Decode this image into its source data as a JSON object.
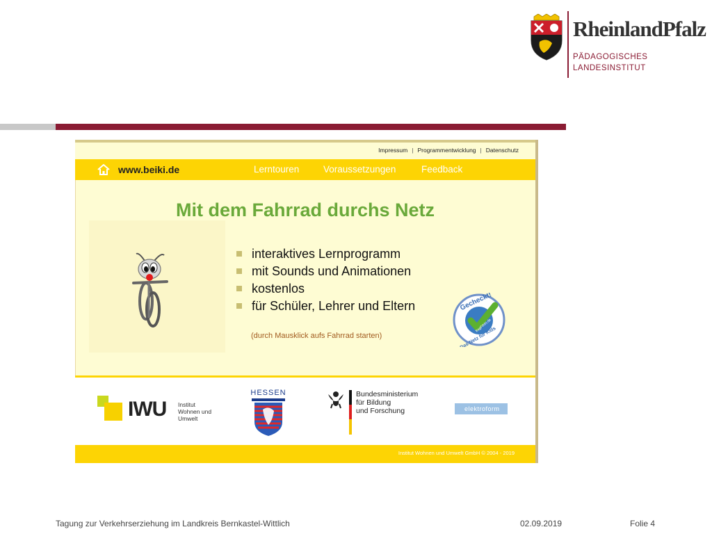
{
  "logo": {
    "title": "RheinlandPfalz",
    "line1": "PÄDAGOGISCHES",
    "line2": "LANDESINSTITUT"
  },
  "site": {
    "top_links": [
      "Impressum",
      "Programmentwicklung",
      "Datenschutz"
    ],
    "url": "www.beiki.de",
    "nav": [
      "Lerntouren",
      "Voraussetzungen",
      "Feedback"
    ],
    "headline": "Mit dem Fahrrad durchs Netz",
    "features": [
      "interaktives Lernprogramm",
      "mit Sounds und Animationen",
      "kostenlos",
      "für Schüler, Lehrer und Eltern"
    ],
    "hint": "(durch Mausklick aufs Fahrrad starten)",
    "badge": {
      "top": "Gecheckt!",
      "mid": "fragFINN.de",
      "bottom": "Das Netz für Kids"
    },
    "partners": {
      "iwu_mark": "IWU",
      "iwu_sub": [
        "Institut",
        "Wohnen und",
        "Umwelt"
      ],
      "hessen": "HESSEN",
      "bmbf": [
        "Bundesministerium",
        "für Bildung",
        "und Forschung"
      ],
      "elektro": "elektroform"
    },
    "copyright": "Institut Wohnen und Umwelt GmbH © 2004 - 2019"
  },
  "footer": {
    "event": "Tagung zur Verkehrserziehung im Landkreis Bernkastel-Wittlich",
    "date": "02.09.2019",
    "folio": "Folie 4"
  },
  "colors": {
    "brand_red": "#8a1b33",
    "site_yellow": "#fdd404",
    "headline_green": "#6aa93a",
    "background_cream": "#fefcd3"
  }
}
